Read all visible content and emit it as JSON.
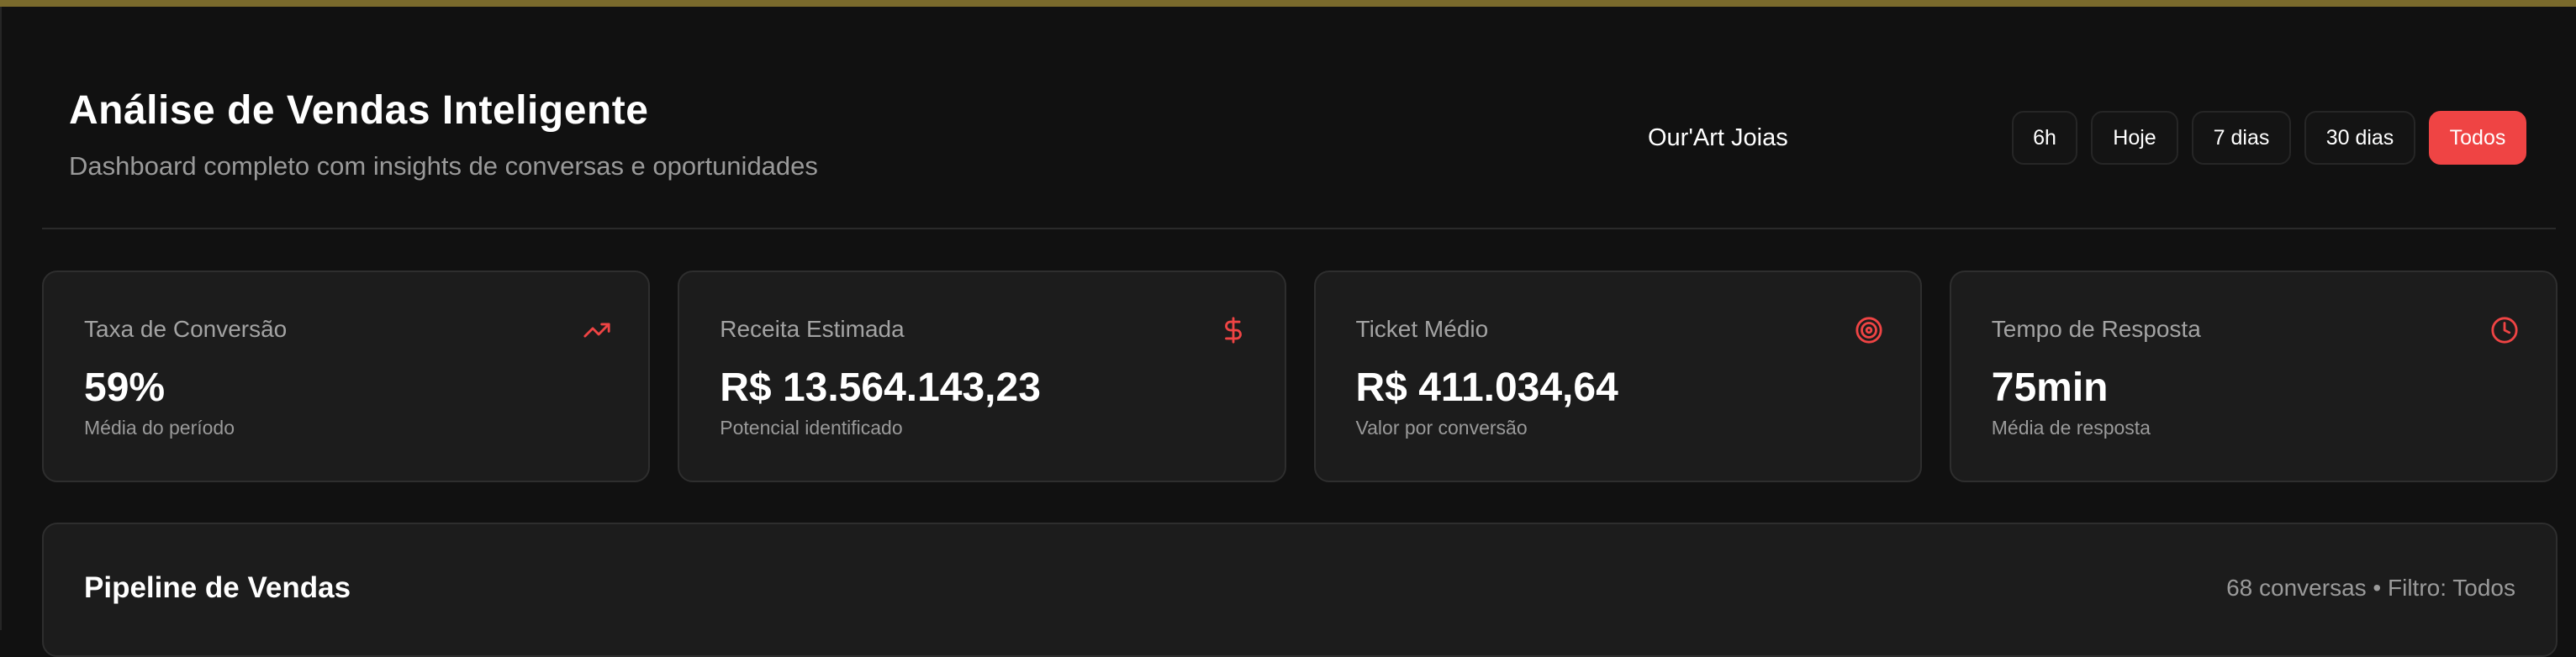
{
  "header": {
    "title": "Análise de Vendas Inteligente",
    "subtitle": "Dashboard completo com insights de conversas e oportunidades",
    "company": "Our'Art Joias",
    "filters": [
      {
        "label": "6h",
        "active": false
      },
      {
        "label": "Hoje",
        "active": false
      },
      {
        "label": "7 dias",
        "active": false
      },
      {
        "label": "30 dias",
        "active": false
      },
      {
        "label": "Todos",
        "active": true
      }
    ]
  },
  "metrics": [
    {
      "label": "Taxa de Conversão",
      "value": "59%",
      "sub": "Média do período",
      "icon": "trending-up-icon"
    },
    {
      "label": "Receita Estimada",
      "value": "R$ 13.564.143,23",
      "sub": "Potencial identificado",
      "icon": "dollar-icon"
    },
    {
      "label": "Ticket Médio",
      "value": "R$ 411.034,64",
      "sub": "Valor por conversão",
      "icon": "target-icon"
    },
    {
      "label": "Tempo de Resposta",
      "value": "75min",
      "sub": "Média de resposta",
      "icon": "clock-icon"
    }
  ],
  "pipeline": {
    "title": "Pipeline de Vendas",
    "meta": "68 conversas • Filtro: Todos"
  },
  "colors": {
    "accent": "#ef4444",
    "background": "#111111",
    "card": "#1c1c1c",
    "top_bar": "#7a6a2c"
  }
}
